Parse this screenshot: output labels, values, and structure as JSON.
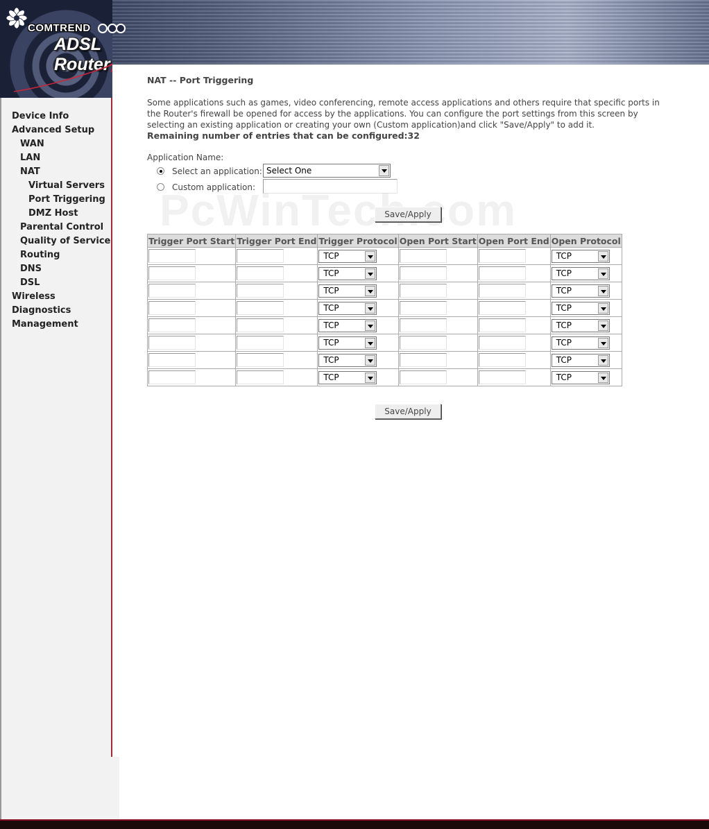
{
  "header": {
    "brand": "COMTREND",
    "product": "ADSL Router"
  },
  "sidebar": {
    "items": [
      {
        "label": "Device Info",
        "level": 0
      },
      {
        "label": "Advanced Setup",
        "level": 0
      },
      {
        "label": "WAN",
        "level": 1
      },
      {
        "label": "LAN",
        "level": 1
      },
      {
        "label": "NAT",
        "level": 1
      },
      {
        "label": "Virtual Servers",
        "level": 2
      },
      {
        "label": "Port Triggering",
        "level": 2
      },
      {
        "label": "DMZ Host",
        "level": 2
      },
      {
        "label": "Parental Control",
        "level": 1
      },
      {
        "label": "Quality of Service",
        "level": 1
      },
      {
        "label": "Routing",
        "level": 1
      },
      {
        "label": "DNS",
        "level": 1
      },
      {
        "label": "DSL",
        "level": 1
      },
      {
        "label": "Wireless",
        "level": 0
      },
      {
        "label": "Diagnostics",
        "level": 0
      },
      {
        "label": "Management",
        "level": 0
      }
    ]
  },
  "main": {
    "title": "NAT -- Port Triggering",
    "description": "Some applications such as games, video conferencing, remote access applications and others require that specific ports in the Router's firewall be opened for access by the applications. You can configure the port settings from this screen by selecting an existing application or creating your own (Custom application)and click \"Save/Apply\" to add it.",
    "remaining": "Remaining number of entries that can be configured:32",
    "app_name_label": "Application Name:",
    "select_app_label": "Select an application:",
    "select_app_value": "Select One",
    "custom_app_label": "Custom application:",
    "custom_app_value": "",
    "save_apply": "Save/Apply",
    "watermark": "PcWinTech.com"
  },
  "table": {
    "headers": [
      "Trigger Port Start",
      "Trigger Port End",
      "Trigger Protocol",
      "Open Port Start",
      "Open Port End",
      "Open Protocol"
    ],
    "rows": [
      {
        "trigger_start": "",
        "trigger_end": "",
        "trigger_protocol": "TCP",
        "open_start": "",
        "open_end": "",
        "open_protocol": "TCP"
      },
      {
        "trigger_start": "",
        "trigger_end": "",
        "trigger_protocol": "TCP",
        "open_start": "",
        "open_end": "",
        "open_protocol": "TCP"
      },
      {
        "trigger_start": "",
        "trigger_end": "",
        "trigger_protocol": "TCP",
        "open_start": "",
        "open_end": "",
        "open_protocol": "TCP"
      },
      {
        "trigger_start": "",
        "trigger_end": "",
        "trigger_protocol": "TCP",
        "open_start": "",
        "open_end": "",
        "open_protocol": "TCP"
      },
      {
        "trigger_start": "",
        "trigger_end": "",
        "trigger_protocol": "TCP",
        "open_start": "",
        "open_end": "",
        "open_protocol": "TCP"
      },
      {
        "trigger_start": "",
        "trigger_end": "",
        "trigger_protocol": "TCP",
        "open_start": "",
        "open_end": "",
        "open_protocol": "TCP"
      },
      {
        "trigger_start": "",
        "trigger_end": "",
        "trigger_protocol": "TCP",
        "open_start": "",
        "open_end": "",
        "open_protocol": "TCP"
      },
      {
        "trigger_start": "",
        "trigger_end": "",
        "trigger_protocol": "TCP",
        "open_start": "",
        "open_end": "",
        "open_protocol": "TCP"
      }
    ]
  },
  "colors": {
    "sidebar_border": "#a3283a",
    "sidebar_bg": "#f2f2f2",
    "table_header_bg": "#dcdcdc"
  }
}
